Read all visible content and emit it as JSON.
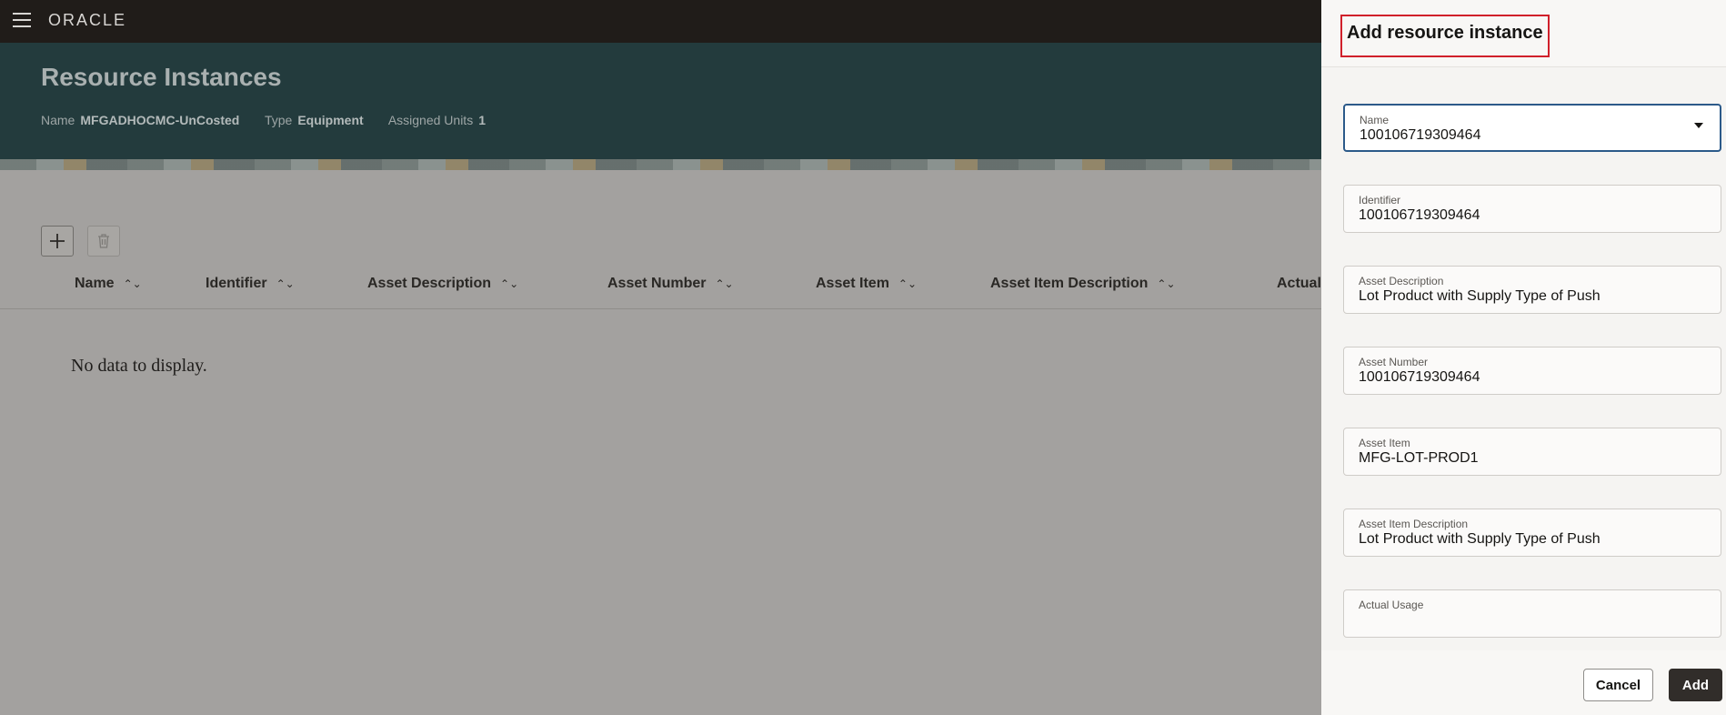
{
  "topbar": {
    "logo": "ORACLE",
    "menu_icon": "hamburger-icon"
  },
  "header": {
    "title": "Resource Instances",
    "meta": [
      {
        "label": "Name",
        "value": "MFGADHOCMC-UnCosted"
      },
      {
        "label": "Type",
        "value": "Equipment"
      },
      {
        "label": "Assigned Units",
        "value": "1"
      }
    ]
  },
  "toolbar": {
    "add_icon": "plus-icon",
    "delete_icon": "trash-icon"
  },
  "table": {
    "columns": [
      "Name",
      "Identifier",
      "Asset Description",
      "Asset Number",
      "Asset Item",
      "Asset Item Description",
      "Actual"
    ],
    "empty_text": "No data to display."
  },
  "drawer": {
    "title": "Add resource instance",
    "fields": [
      {
        "label": "Name",
        "value": "100106719309464"
      },
      {
        "label": "Identifier",
        "value": "100106719309464"
      },
      {
        "label": "Asset Description",
        "value": "Lot Product with Supply Type of Push"
      },
      {
        "label": "Asset Number",
        "value": "100106719309464"
      },
      {
        "label": "Asset Item",
        "value": "MFG-LOT-PROD1"
      },
      {
        "label": "Asset Item Description",
        "value": "Lot Product with Supply Type of Push"
      },
      {
        "label": "Actual Usage",
        "value": ""
      }
    ],
    "cancel_label": "Cancel",
    "add_label": "Add"
  },
  "colors": {
    "accent": "#2c5a8a",
    "highlight": "#d0202a",
    "header_bg": "#233b3d",
    "topbar_bg": "#201c19"
  }
}
